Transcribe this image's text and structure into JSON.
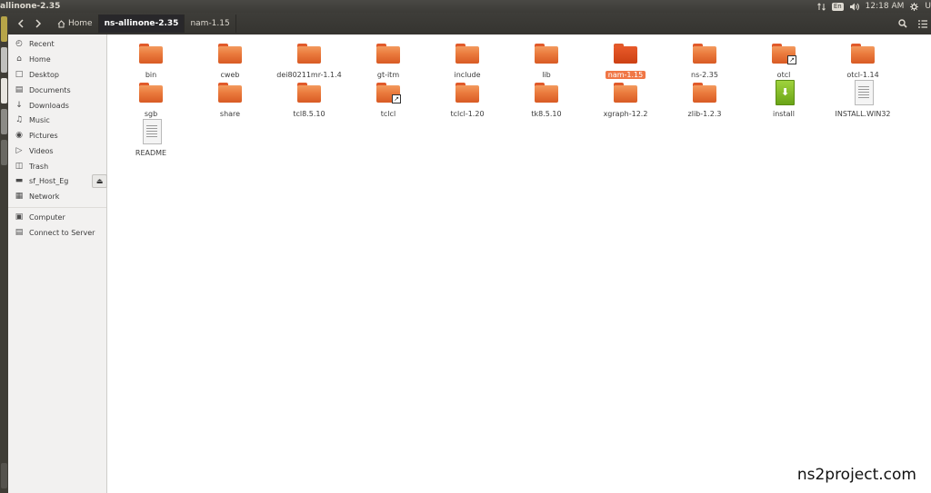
{
  "window": {
    "title": "allinone-2.35"
  },
  "panel": {
    "keyboard_layout": "En",
    "time": "12:18 AM",
    "user_initial": "U",
    "icons": [
      "network-arrows-icon",
      "keyboard-layout-icon",
      "volume-icon",
      "session-gear-icon"
    ]
  },
  "toolbar": {
    "back_icon": "chevron-left-icon",
    "forward_icon": "chevron-right-icon",
    "breadcrumbs": [
      {
        "label": "Home",
        "icon": "home-icon"
      },
      {
        "label": "ns-allinone-2.35",
        "active": true
      },
      {
        "label": "nam-1.15"
      }
    ],
    "search_icon": "search-icon",
    "view_icon": "list-view-icon"
  },
  "sidebar": {
    "items": [
      {
        "label": "Recent",
        "icon": "clock-icon"
      },
      {
        "label": "Home",
        "icon": "home-icon"
      },
      {
        "label": "Desktop",
        "icon": "folder-icon"
      },
      {
        "label": "Documents",
        "icon": "document-icon"
      },
      {
        "label": "Downloads",
        "icon": "download-arrow-icon"
      },
      {
        "label": "Music",
        "icon": "music-note-icon"
      },
      {
        "label": "Pictures",
        "icon": "camera-icon"
      },
      {
        "label": "Videos",
        "icon": "film-icon"
      },
      {
        "label": "Trash",
        "icon": "trash-icon"
      },
      {
        "label": "sf_Host_Eg",
        "icon": "drive-icon"
      },
      {
        "label": "Network",
        "icon": "network-icon"
      },
      {
        "label": "Computer",
        "icon": "computer-icon"
      },
      {
        "label": "Connect to Server",
        "icon": "server-icon"
      }
    ],
    "eject_icon": "eject-icon"
  },
  "files": [
    {
      "name": "bin",
      "type": "folder"
    },
    {
      "name": "cweb",
      "type": "folder"
    },
    {
      "name": "dei80211mr-1.1.4",
      "type": "folder"
    },
    {
      "name": "gt-itm",
      "type": "folder"
    },
    {
      "name": "include",
      "type": "folder"
    },
    {
      "name": "lib",
      "type": "folder"
    },
    {
      "name": "nam-1.15",
      "type": "folder",
      "selected": true
    },
    {
      "name": "ns-2.35",
      "type": "folder"
    },
    {
      "name": "otcl",
      "type": "folder-link"
    },
    {
      "name": "otcl-1.14",
      "type": "folder"
    },
    {
      "name": "sgb",
      "type": "folder"
    },
    {
      "name": "share",
      "type": "folder"
    },
    {
      "name": "tcl8.5.10",
      "type": "folder"
    },
    {
      "name": "tclcl",
      "type": "folder-link"
    },
    {
      "name": "tclcl-1.20",
      "type": "folder"
    },
    {
      "name": "tk8.5.10",
      "type": "folder"
    },
    {
      "name": "xgraph-12.2",
      "type": "folder"
    },
    {
      "name": "zlib-1.2.3",
      "type": "folder"
    },
    {
      "name": "install",
      "type": "executable"
    },
    {
      "name": "INSTALL.WIN32",
      "type": "text"
    },
    {
      "name": "README",
      "type": "text"
    }
  ],
  "watermark": "ns2project.com",
  "colors": {
    "accent": "#f07746",
    "folder": "#ea7a3c",
    "panel": "#3c3b37"
  }
}
